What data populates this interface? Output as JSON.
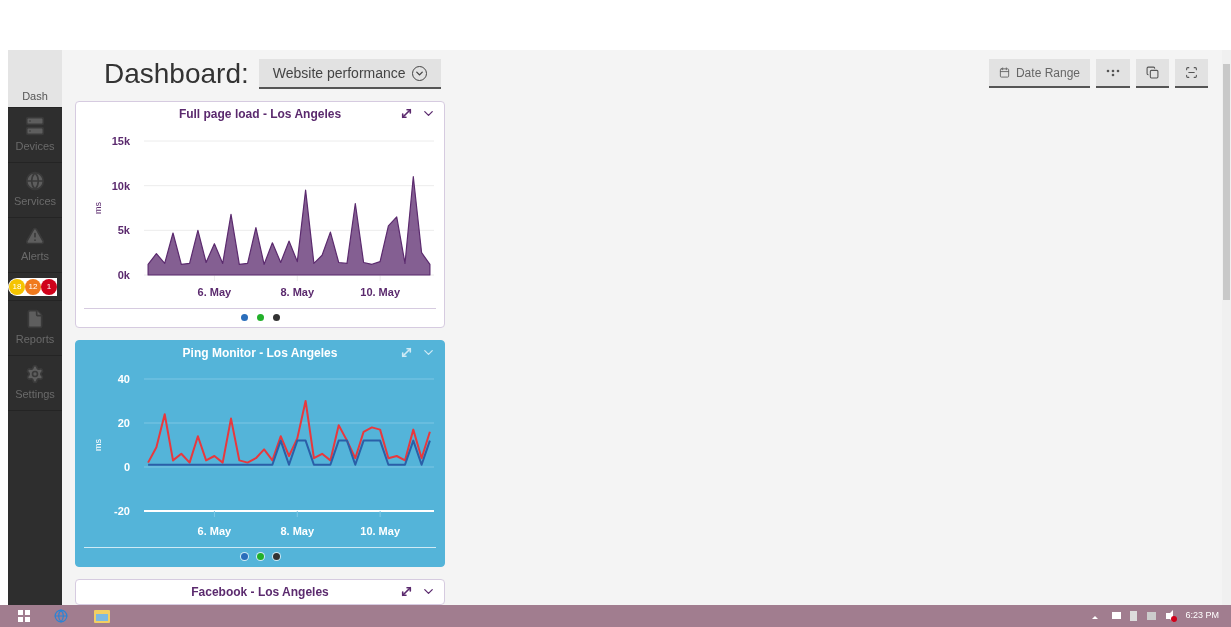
{
  "page_title": "Dashboard:",
  "dashboard_select": {
    "value": "Website performance"
  },
  "toolbar": [
    {
      "kind": "date",
      "label": "Date Range"
    },
    {
      "kind": "dots"
    },
    {
      "kind": "copy"
    },
    {
      "kind": "focus"
    }
  ],
  "sidebar": {
    "items": [
      {
        "kind": "dash",
        "label": "Dash",
        "selected": true
      },
      {
        "kind": "devices",
        "label": "Devices",
        "selected": false
      },
      {
        "kind": "services",
        "label": "Services",
        "selected": false
      },
      {
        "kind": "alerts",
        "label": "Alerts",
        "selected": false
      },
      {
        "kind": "reports",
        "label": "Reports",
        "selected": false
      },
      {
        "kind": "settings",
        "label": "Settings",
        "selected": false
      }
    ],
    "alert_counts": [
      {
        "count": "18",
        "color": "#f5c400"
      },
      {
        "count": "12",
        "color": "#f07a1e"
      },
      {
        "count": "1",
        "color": "#d0021b"
      }
    ]
  },
  "widgets": [
    {
      "title": "Full page load - Los Angeles",
      "kind": "light",
      "legend_dots": [
        {
          "color": "#2a6ebb"
        },
        {
          "color": "#22b02a"
        },
        {
          "color": "#333333"
        }
      ],
      "chart_data": {
        "type": "area",
        "ylabel": "ms",
        "ylim": [
          0,
          15000
        ],
        "yticks": [
          {
            "value": 0,
            "label": "0k"
          },
          {
            "value": 5000,
            "label": "5k"
          },
          {
            "value": 10000,
            "label": "10k"
          },
          {
            "value": 15000,
            "label": "15k"
          }
        ],
        "categories": [
          null,
          null,
          null,
          null,
          null,
          null,
          null,
          null,
          "6. May",
          null,
          null,
          null,
          null,
          null,
          null,
          null,
          null,
          null,
          "8. May",
          null,
          null,
          null,
          null,
          null,
          null,
          null,
          null,
          null,
          "10. May",
          null,
          null,
          null,
          null,
          null,
          null
        ],
        "series": [
          {
            "color": "#5b2a6e",
            "values": [
              1200,
              2400,
              1300,
              4700,
              1200,
              1300,
              5000,
              1400,
              3500,
              1300,
              6800,
              1200,
              1300,
              5300,
              1200,
              3600,
              1400,
              3800,
              1500,
              9500,
              1300,
              2200,
              4800,
              1400,
              1300,
              8000,
              1400,
              1200,
              1500,
              5500,
              6500,
              1300,
              11000,
              2500,
              1200
            ]
          }
        ]
      }
    },
    {
      "title": "Ping Monitor - Los Angeles",
      "kind": "blue",
      "legend_dots": [
        {
          "color": "#2a6ebb"
        },
        {
          "color": "#22b02a"
        },
        {
          "color": "#333333"
        }
      ],
      "chart_data": {
        "type": "line",
        "ylabel": "ms",
        "ylim": [
          -20,
          40
        ],
        "yticks": [
          -20,
          0,
          20,
          40
        ],
        "categories": [
          null,
          null,
          null,
          null,
          null,
          null,
          null,
          null,
          "6. May",
          null,
          null,
          null,
          null,
          null,
          null,
          null,
          null,
          null,
          "8. May",
          null,
          null,
          null,
          null,
          null,
          null,
          null,
          null,
          null,
          "10. May",
          null,
          null,
          null,
          null,
          null,
          null
        ],
        "series": [
          {
            "color": "#e8383d",
            "values": [
              2,
              9,
              24,
              3,
              6,
              2,
              14,
              3,
              5,
              2,
              22,
              3,
              2,
              4,
              8,
              3,
              14,
              5,
              13,
              30,
              4,
              6,
              3,
              19,
              12,
              4,
              16,
              18,
              17,
              4,
              5,
              3,
              17,
              4,
              16
            ]
          },
          {
            "color": "#2a5fa8",
            "values": [
              1,
              1,
              1,
              1,
              1,
              1,
              1,
              1,
              1,
              1,
              1,
              1,
              1,
              1,
              1,
              1,
              12,
              1,
              12,
              12,
              1,
              1,
              1,
              12,
              12,
              1,
              12,
              12,
              12,
              1,
              1,
              1,
              12,
              1,
              12
            ]
          }
        ]
      }
    },
    {
      "title": "Facebook - Los Angeles",
      "kind": "light"
    }
  ],
  "taskbar": {
    "clock": "6:23 PM"
  }
}
